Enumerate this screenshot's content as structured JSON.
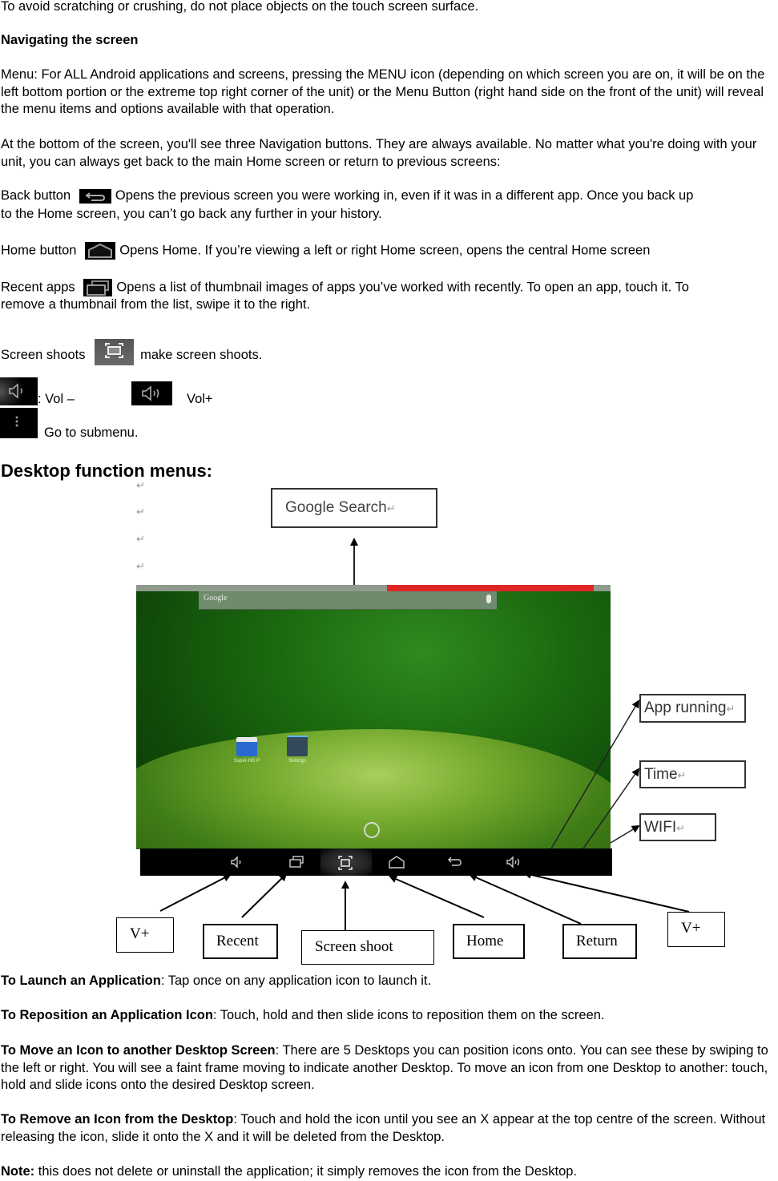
{
  "intro": "To avoid scratching or crushing, do not place objects on the touch screen surface.",
  "nav_heading": "Navigating the screen",
  "menu_paragraph": "Menu: For ALL Android applications and screens, pressing the MENU icon (depending on which screen you are on, it will be on the left bottom portion or the extreme top right corner of the unit) or the Menu Button (right hand side on the front of the unit) will reveal the menu items and options available with that operation.",
  "nav_buttons_paragraph": "At the bottom of the screen, you'll see three Navigation buttons. They are always available. No matter what you're doing with your unit, you can always get back to the main Home screen or return to previous screens:",
  "buttons": {
    "back": {
      "label": "Back button",
      "icon": "back-arrow-icon",
      "desc": ": Opens the previous screen you were working in, even if it was in a different app. Once you back up",
      "desc2": "to the Home screen, you can’t go back any further in your history."
    },
    "home": {
      "label": "Home button",
      "icon": "home-icon",
      "desc": ": Opens Home. If you’re viewing a left or right Home screen, opens the central Home screen"
    },
    "recent": {
      "label": "Recent apps",
      "icon": "recent-apps-icon",
      "desc": ": Opens a list of thumbnail images of apps you’ve worked with recently. To open an app, touch it. To",
      "desc2": "remove a thumbnail from the list, swipe it to the right."
    },
    "screenshot": {
      "label": "Screen shoots",
      "icon": "screenshot-icon",
      "desc": "make screen shoots."
    },
    "vol_down": {
      "icon": "volume-down-icon",
      "desc": ": Vol –"
    },
    "vol_up": {
      "icon": "volume-up-icon",
      "desc": "Vol+"
    },
    "submenu": {
      "icon": "overflow-menu-icon",
      "desc": "Go to submenu."
    }
  },
  "desktop_heading": "Desktop function menus:",
  "figure": {
    "pilcrow": "↵",
    "search_bar_label": "Google",
    "apps": [
      {
        "name": "Super-HD P",
        "icon": "video-player-icon"
      },
      {
        "name": "Settings",
        "icon": "settings-icon"
      }
    ],
    "status_colors": {
      "bar": "#8e9a8c",
      "alert": "#e02525"
    },
    "callouts_top": {
      "google_search": "Google Search"
    },
    "callouts_right": [
      "App running",
      "Time",
      "WIFI"
    ],
    "callouts_bottom": [
      "V+",
      "Recent",
      "Screen shoot",
      "Home",
      "Return",
      "V+"
    ]
  },
  "tips": [
    {
      "title": "To Launch an Application",
      "text": ": Tap once on any application icon to launch it."
    },
    {
      "title": "To Reposition an Application Icon",
      "text": ": Touch, hold and then slide icons to reposition them on the screen."
    },
    {
      "title": "To Move an Icon to another Desktop Screen",
      "text": ": There are 5 Desktops you can position icons onto. You can see these by swiping to the left or right. You will see a faint frame moving to indicate another Desktop. To move an icon from one Desktop to another: touch, hold and slide icons onto the desired Desktop screen."
    },
    {
      "title": "To Remove an Icon from the Desktop",
      "text": ": Touch and hold the icon until you see an X appear at the top centre of the screen. Without releasing the icon, slide it onto the X and it will be deleted from the Desktop."
    },
    {
      "title": "Note:",
      "text": " this does not delete or uninstall the application; it simply removes the icon from the Desktop."
    }
  ]
}
